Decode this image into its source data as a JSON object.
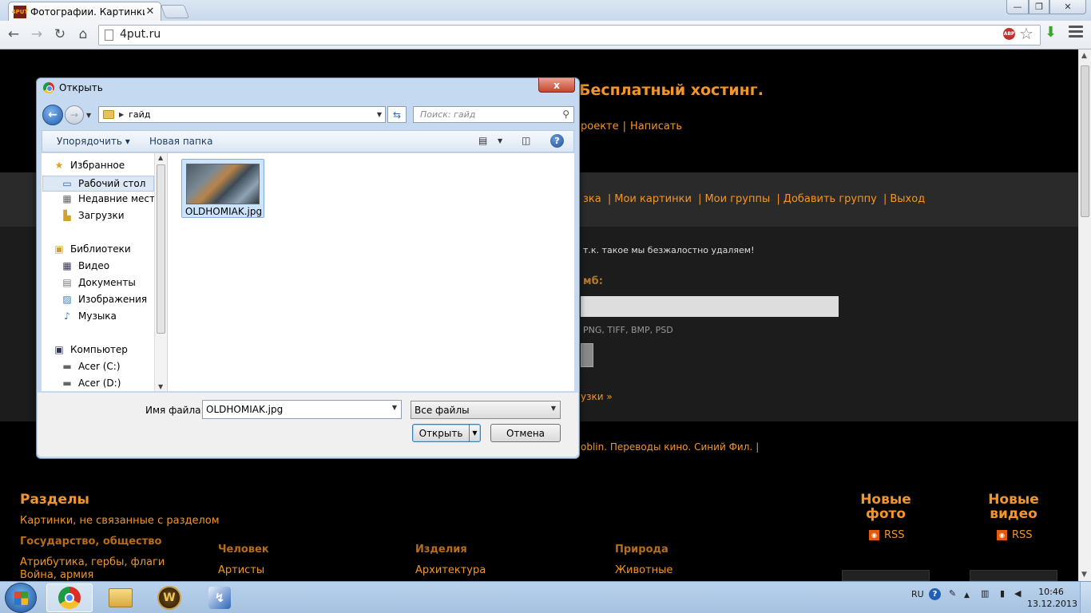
{
  "browser": {
    "tab": {
      "favicon_text": "4PUT",
      "title": "Фотографии. Картинки. Б",
      "close": "✕"
    },
    "url": "4put.ru",
    "window_controls": {
      "minimize": "—",
      "maximize": "❐",
      "close": "✕"
    },
    "nav": {
      "back": "←",
      "forward": "→",
      "reload": "↻",
      "home": "⌂"
    },
    "extensions": {
      "abp": "ABP",
      "star": "☆",
      "download": "⬇"
    }
  },
  "page": {
    "site_title": "Бесплатный хостинг.",
    "top_links": [
      "роекте",
      "Написать"
    ],
    "nav_links": [
      "зка",
      "Мои картинки",
      "Мои группы",
      "Добавить группу",
      "Выход"
    ],
    "notice": "т.к. такое мы безжалостно удаляем!",
    "mb_label": "мб:",
    "formats": "PNG, TIFF, BMP, PSD",
    "more_link": "узки »",
    "footer_links": "oblin. Переводы кино. Синий Фил.",
    "footer_bar": "|",
    "sections_title": "Разделы",
    "sections": {
      "unrelated": "Картинки, не связанные с разделом",
      "state": "Государство, общество",
      "attributes": "Атрибутика, гербы, флаги",
      "war": "Война, армия"
    },
    "categories": [
      {
        "title": "Человек",
        "first": "Артисты"
      },
      {
        "title": "Изделия",
        "first": "Архитектура"
      },
      {
        "title": "Природа",
        "first": "Животные"
      }
    ],
    "new_photo": {
      "line1": "Новые",
      "line2": "фото",
      "rss": "RSS"
    },
    "new_video": {
      "line1": "Новые",
      "line2": "видео",
      "rss": "RSS"
    }
  },
  "dialog": {
    "title": "Открыть",
    "close": "x",
    "path": "гайд",
    "search_placeholder": "Поиск: гайд",
    "organize": "Упорядочить",
    "new_folder": "Новая папка",
    "help": "?",
    "tree": [
      {
        "label": "Избранное",
        "icon": "star-icon"
      },
      {
        "label": "Рабочий стол",
        "icon": "desktop-icon"
      },
      {
        "label": "Недавние места",
        "icon": "recent-places-icon"
      },
      {
        "label": "Загрузки",
        "icon": "downloads-icon"
      },
      {
        "label": "Библиотеки",
        "icon": "libraries-icon"
      },
      {
        "label": "Видео",
        "icon": "video-icon"
      },
      {
        "label": "Документы",
        "icon": "documents-icon"
      },
      {
        "label": "Изображения",
        "icon": "pictures-icon"
      },
      {
        "label": "Музыка",
        "icon": "music-icon"
      },
      {
        "label": "Компьютер",
        "icon": "computer-icon"
      },
      {
        "label": "Acer (C:)",
        "icon": "drive-icon"
      },
      {
        "label": "Acer (D:)",
        "icon": "drive-icon"
      }
    ],
    "selected_tree_item": "Рабочий стол",
    "files": [
      {
        "name": "OLDHOMIAK.jpg"
      }
    ],
    "filename_label": "Имя файла:",
    "filename_value": "OLDHOMIAK.jpg",
    "filetype": "Все файлы",
    "open_button": "Открыть",
    "cancel_button": "Отмена"
  },
  "taskbar": {
    "apps": [
      "chrome",
      "explorer",
      "world-of-warcraft",
      "app"
    ],
    "active_app": "chrome",
    "wow_letter": "W",
    "lang": "RU",
    "help": "?",
    "time": "10:46",
    "date": "13.12.2013"
  }
}
